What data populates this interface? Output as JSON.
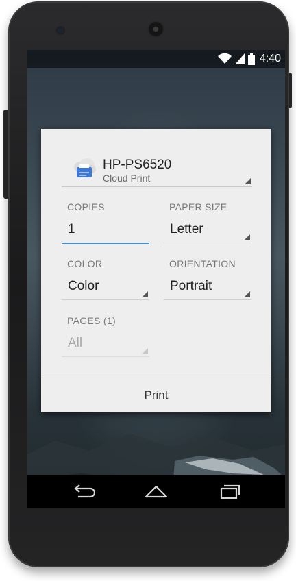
{
  "status_bar": {
    "time": "4:40",
    "icons": [
      "wifi-icon",
      "signal-icon",
      "battery-icon"
    ]
  },
  "print_dialog": {
    "printer": {
      "name": "HP-PS6520",
      "subtitle": "Cloud Print",
      "icon": "cloud-printer-icon"
    },
    "copies": {
      "label": "COPIES",
      "value": "1"
    },
    "paper_size": {
      "label": "PAPER SIZE",
      "value": "Letter"
    },
    "color": {
      "label": "COLOR",
      "value": "Color"
    },
    "orientation": {
      "label": "ORIENTATION",
      "value": "Portrait"
    },
    "pages": {
      "label": "PAGES (1)",
      "value": "All"
    },
    "print_button": "Print"
  },
  "nav_bar": {
    "buttons": [
      "back-icon",
      "home-icon",
      "recent-apps-icon"
    ]
  },
  "colors": {
    "accent": "#4a90c8",
    "dialog_bg": "#eeeeee",
    "printer_icon_blue": "#3b78d8"
  }
}
